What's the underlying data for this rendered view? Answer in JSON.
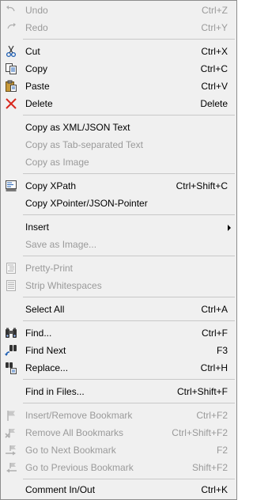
{
  "menu": {
    "undo": {
      "label": "Undo",
      "shortcut": "Ctrl+Z"
    },
    "redo": {
      "label": "Redo",
      "shortcut": "Ctrl+Y"
    },
    "cut": {
      "label": "Cut",
      "shortcut": "Ctrl+X"
    },
    "copy": {
      "label": "Copy",
      "shortcut": "Ctrl+C"
    },
    "paste": {
      "label": "Paste",
      "shortcut": "Ctrl+V"
    },
    "delete": {
      "label": "Delete",
      "shortcut": "Delete"
    },
    "copy_xml_json": {
      "label": "Copy as XML/JSON Text"
    },
    "copy_tab_separated": {
      "label": "Copy as Tab-separated Text"
    },
    "copy_image": {
      "label": "Copy as Image"
    },
    "copy_xpath": {
      "label": "Copy XPath",
      "shortcut": "Ctrl+Shift+C"
    },
    "copy_xpointer": {
      "label": "Copy XPointer/JSON-Pointer"
    },
    "insert": {
      "label": "Insert"
    },
    "save_image": {
      "label": "Save as Image..."
    },
    "pretty_print": {
      "label": "Pretty-Print"
    },
    "strip_whitespaces": {
      "label": "Strip Whitespaces"
    },
    "select_all": {
      "label": "Select All",
      "shortcut": "Ctrl+A"
    },
    "find": {
      "label": "Find...",
      "shortcut": "Ctrl+F"
    },
    "find_next": {
      "label": "Find Next",
      "shortcut": "F3"
    },
    "replace": {
      "label": "Replace...",
      "shortcut": "Ctrl+H"
    },
    "find_in_files": {
      "label": "Find in Files...",
      "shortcut": "Ctrl+Shift+F"
    },
    "insert_remove_bookmark": {
      "label": "Insert/Remove Bookmark",
      "shortcut": "Ctrl+F2"
    },
    "remove_all_bookmarks": {
      "label": "Remove All Bookmarks",
      "shortcut": "Ctrl+Shift+F2"
    },
    "next_bookmark": {
      "label": "Go to Next Bookmark",
      "shortcut": "F2"
    },
    "previous_bookmark": {
      "label": "Go to Previous Bookmark",
      "shortcut": "Shift+F2"
    },
    "comment": {
      "label": "Comment In/Out",
      "shortcut": "Ctrl+K"
    }
  },
  "icons": {
    "undo": "undo-icon",
    "redo": "redo-icon",
    "cut": "scissors-icon",
    "copy": "copy-icon",
    "paste": "paste-icon",
    "delete": "delete-x-icon",
    "copy_xpath": "xpath-icon",
    "pretty_print": "pretty-print-icon",
    "strip_whitespaces": "strip-whitespace-icon",
    "find": "binoculars-icon",
    "find_next": "find-next-icon",
    "replace": "replace-icon",
    "bookmark": "bookmark-flag-icon"
  },
  "colors": {
    "menu_bg": "#f0f0f0",
    "disabled_text": "#9a9a9a",
    "delete_icon": "#d8261c",
    "separator": "#c8c8c8"
  }
}
